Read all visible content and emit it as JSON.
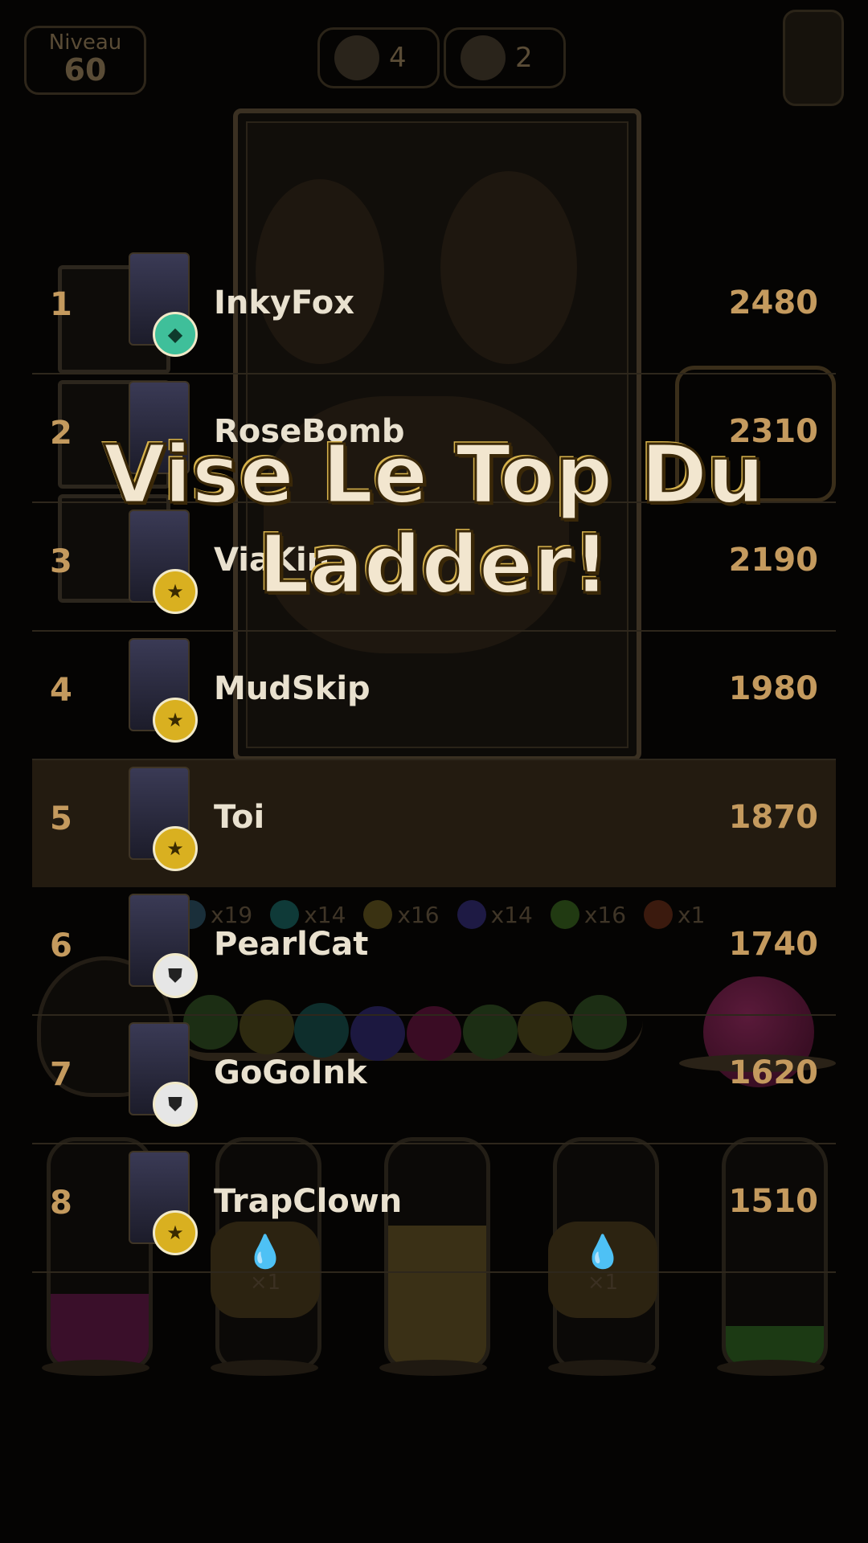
{
  "hud": {
    "level_label": "Niveau",
    "level_value": "60",
    "octopus_count": "4",
    "robot_count": "2"
  },
  "ball_counts": [
    {
      "label": "x19",
      "color": "#1a2f3a"
    },
    {
      "label": "x14",
      "color": "#0f3a38"
    },
    {
      "label": "x16",
      "color": "#3a3212"
    },
    {
      "label": "x14",
      "color": "#1e1a44"
    },
    {
      "label": "x16",
      "color": "#213a12"
    },
    {
      "label": "x1",
      "color": "#3b1a0e"
    }
  ],
  "drop_badges": [
    "×1",
    "×1"
  ],
  "headline": {
    "line1": "Vise Le Top Du",
    "line2": "Ladder!"
  },
  "leaderboard": [
    {
      "rank": "1",
      "name": "InkyFox",
      "score": "2480",
      "badge": "diamond"
    },
    {
      "rank": "2",
      "name": "RoseBomb",
      "score": "2310",
      "badge": "none"
    },
    {
      "rank": "3",
      "name": "ViaKin",
      "score": "2190",
      "badge": "star"
    },
    {
      "rank": "4",
      "name": "MudSkip",
      "score": "1980",
      "badge": "star"
    },
    {
      "rank": "5",
      "name": "Toi",
      "score": "1870",
      "badge": "star"
    },
    {
      "rank": "6",
      "name": "PearlCat",
      "score": "1740",
      "badge": "shield"
    },
    {
      "rank": "7",
      "name": "GoGoInk",
      "score": "1620",
      "badge": "shield"
    },
    {
      "rank": "8",
      "name": "TrapClown",
      "score": "1510",
      "badge": "star"
    }
  ],
  "colors": {
    "accent_gold": "#c49a5e",
    "highlight_row": "#231b10",
    "headline_fill": "#f2e6cf"
  }
}
